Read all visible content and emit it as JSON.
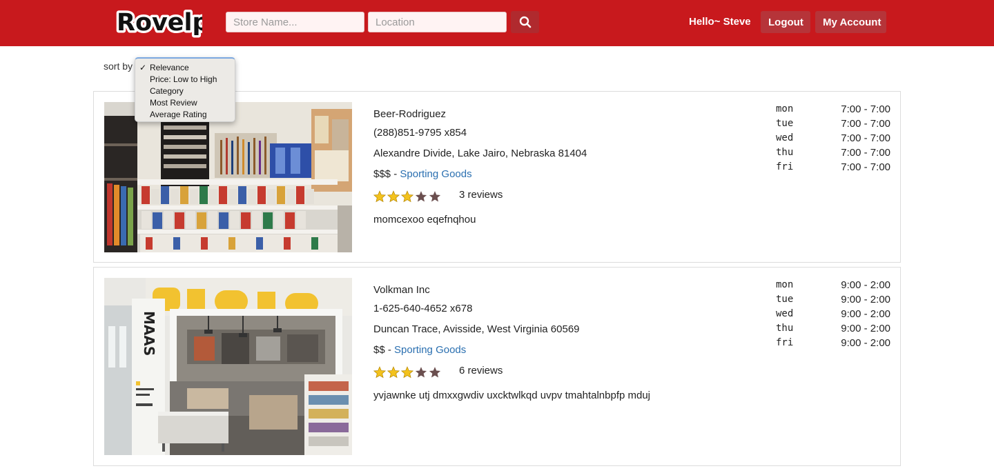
{
  "brand": {
    "logo_text": "Rovelp",
    "color": "#c8191d"
  },
  "search": {
    "store_placeholder": "Store Name...",
    "location_placeholder": "Location",
    "button_icon": "search-icon"
  },
  "user": {
    "greeting": "Hello~ Steve"
  },
  "nav": {
    "logout_label": "Logout",
    "account_label": "My Account"
  },
  "sort": {
    "label": "sort by",
    "selected": "Relevance",
    "options": [
      "Relevance",
      "Price: Low to High",
      "Category",
      "Most Review",
      "Average Rating"
    ]
  },
  "stores": [
    {
      "name": "Beer-Rodriguez",
      "phone": "(288)851-9795 x854",
      "address": "Alexandre Divide, Lake Jairo, Nebraska 81404",
      "price": "$$$",
      "price_sep": " - ",
      "category": "Sporting Goods",
      "rating": 3,
      "rating_max": 5,
      "reviews": "3 reviews",
      "description": "momcexoo eqefnqhou",
      "hours": [
        {
          "day": "mon",
          "time": "7:00 - 7:00"
        },
        {
          "day": "tue",
          "time": "7:00 - 7:00"
        },
        {
          "day": "wed",
          "time": "7:00 - 7:00"
        },
        {
          "day": "thu",
          "time": "7:00 - 7:00"
        },
        {
          "day": "fri",
          "time": "7:00 - 7:00"
        }
      ]
    },
    {
      "name": "Volkman Inc",
      "phone": "1-625-640-4652 x678",
      "address": "Duncan Trace, Avisside, West Virginia 60569",
      "price": "$$",
      "price_sep": " - ",
      "category": "Sporting Goods",
      "rating": 3,
      "rating_max": 5,
      "reviews": "6 reviews",
      "description": "yvjawnke utj dmxxgwdiv uxcktwlkqd uvpv tmahtalnbpfp mduj",
      "photo_sign": "MAAS",
      "hours": [
        {
          "day": "mon",
          "time": "9:00 - 2:00"
        },
        {
          "day": "tue",
          "time": "9:00 - 2:00"
        },
        {
          "day": "wed",
          "time": "9:00 - 2:00"
        },
        {
          "day": "thu",
          "time": "9:00 - 2:00"
        },
        {
          "day": "fri",
          "time": "9:00 - 2:00"
        }
      ]
    }
  ]
}
